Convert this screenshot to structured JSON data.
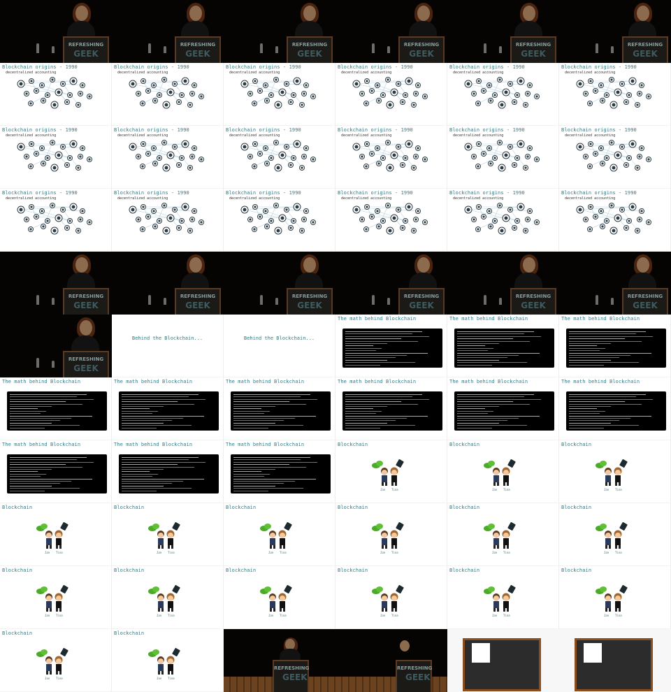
{
  "slides": {
    "origins": {
      "title": "Blockchain origins - 1990",
      "subtitle": "decentralized accounting"
    },
    "behind": {
      "title": "Behind the Blockchain..."
    },
    "math": {
      "title": "The math behind Blockchain"
    },
    "blockchain": {
      "title": "Blockchain",
      "caption_left": "Jan",
      "caption_right": "Tina"
    }
  },
  "podium": {
    "text": "REFRESHING",
    "logo": "GEEK"
  },
  "grid": [
    [
      "stage",
      "stage",
      "stage",
      "stage",
      "stage",
      "stage"
    ],
    [
      "origins",
      "origins",
      "origins",
      "origins",
      "origins",
      "origins"
    ],
    [
      "origins",
      "origins",
      "origins",
      "origins",
      "origins",
      "origins"
    ],
    [
      "origins",
      "origins",
      "origins",
      "origins",
      "origins",
      "origins"
    ],
    [
      "stage",
      "stage",
      "stage",
      "stage",
      "stage",
      "stage"
    ],
    [
      "stage",
      "behind",
      "behind",
      "math",
      "math",
      "math"
    ],
    [
      "math",
      "math",
      "math",
      "math",
      "math",
      "math"
    ],
    [
      "math",
      "math",
      "math",
      "blockchain",
      "blockchain",
      "blockchain"
    ],
    [
      "blockchain",
      "blockchain",
      "blockchain",
      "blockchain",
      "blockchain",
      "blockchain"
    ],
    [
      "blockchain",
      "blockchain",
      "blockchain",
      "blockchain",
      "blockchain",
      "blockchain"
    ],
    [
      "blockchain",
      "blockchain",
      "wide-stage",
      "wide-stage",
      "blackboard",
      "blackboard"
    ]
  ],
  "colors": {
    "title": "#2a7f8a",
    "stage_bg": "#050403",
    "podium_frame": "#5a3b22"
  }
}
